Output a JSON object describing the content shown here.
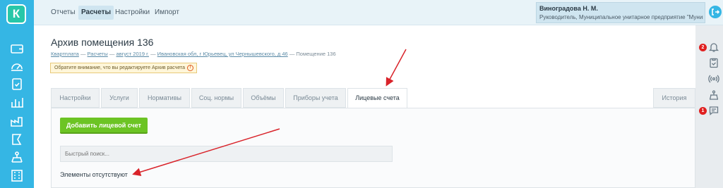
{
  "logo": {
    "letter": "К",
    "icon": "k-logo-icon"
  },
  "sidebar": {
    "items": [
      {
        "icon": "wallet-icon"
      },
      {
        "icon": "gauge-icon"
      },
      {
        "icon": "clipboard-check-icon"
      },
      {
        "icon": "chart-bars-icon"
      },
      {
        "icon": "factory-icon"
      },
      {
        "icon": "flag-icon"
      },
      {
        "icon": "tower-icon"
      },
      {
        "icon": "building-icon"
      }
    ]
  },
  "topnav": {
    "items": [
      "Отчеты",
      "Расчеты",
      "Настройки",
      "Импорт"
    ],
    "active": "Расчеты"
  },
  "user": {
    "name": "Виноградова Н. М.",
    "role": "Руководитель, Муниципальное унитарное предприятие \"Муници..."
  },
  "page": {
    "title": "Архив помещения 136",
    "breadcrumb": {
      "items": [
        "Квартплата",
        "Расчеты",
        "август 2019 г.",
        "Ивановская обл, г Юрьевец, ул Чернышевского, д 46",
        "Помещение 136"
      ],
      "separator": "—"
    },
    "warning": "Обратите внимание, что вы редактируете Архив расчета"
  },
  "tabs": {
    "items": [
      "Настройки",
      "Услуги",
      "Нормативы",
      "Соц. нормы",
      "Объёмы",
      "Приборы учета",
      "Лицевые счета"
    ],
    "active": "Лицевые счета",
    "history": "История"
  },
  "content": {
    "add_button": "Добавить лицевой счет",
    "search_placeholder": "Быстрый поиск...",
    "empty_message": "Элементы отсутствуют"
  },
  "rightpanel": {
    "items": [
      {
        "icon": "bell-icon",
        "badge": "2"
      },
      {
        "icon": "clipboard-icon",
        "badge": ""
      },
      {
        "icon": "signal-icon",
        "badge": ""
      },
      {
        "icon": "tower-icon",
        "badge": ""
      },
      {
        "icon": "chat-icon",
        "badge": "1"
      }
    ]
  },
  "colors": {
    "sidebar": "#35b6e4",
    "logo": "#27c7a8",
    "add_button": "#6cc424",
    "badge": "#e02020",
    "annotation_arrow": "#d9232a"
  }
}
